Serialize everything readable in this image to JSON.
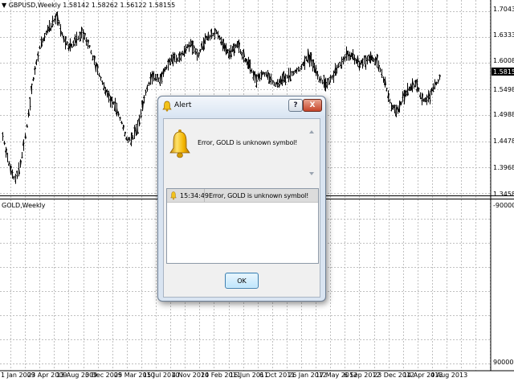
{
  "chart": {
    "main_title": "▼ GBPUSD,Weekly  1.58142 1.58262 1.56122 1.58155",
    "main_price_labels": [
      "1.70430",
      "1.63330",
      "1.60080",
      "1.54980",
      "1.49880",
      "1.44780",
      "1.39680",
      "1.34580"
    ],
    "current_price_label": "1.58155",
    "sub_title": "GOLD,Weekly",
    "sub_top_label": "-9000000",
    "sub_bottom_label": "90000000",
    "time_labels": [
      "1 Jan 2009",
      "23 Apr 2009",
      "13 Aug 2009",
      "3 Dec 2009",
      "25 Mar 2010",
      "15 Jul 2010",
      "4 Nov 2010",
      "24 Feb 2011",
      "16 Jun 2011",
      "6 Oct 2011",
      "26 Jan 2012",
      "17 May 2012",
      "6 Sep 2012",
      "23 Dec 2012",
      "14 Apr 2013",
      "4 Aug 2013"
    ],
    "colors": {
      "bars": "#000000",
      "grid": "#c0c0c0",
      "background": "#ffffff"
    }
  },
  "dialog": {
    "title": "Alert",
    "help_label": "?",
    "close_label": "X",
    "message": "Error, GOLD is unknown symbol!",
    "log": [
      {
        "time": "15:34:49",
        "message": "Error, GOLD is unknown symbol!"
      }
    ],
    "ok_label": "OK"
  }
}
